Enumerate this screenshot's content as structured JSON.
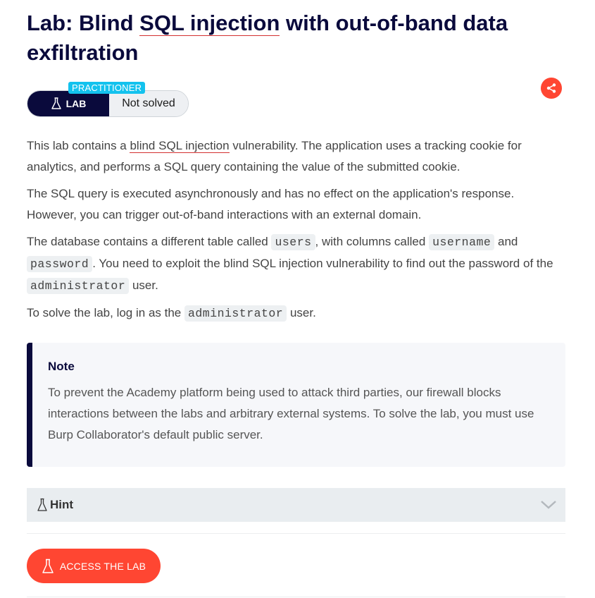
{
  "title": {
    "prefix": "Lab: Blind ",
    "link": "SQL injection",
    "suffix": " with out-of-band data exfiltration"
  },
  "badge": {
    "level": "PRACTITIONER",
    "lab_label": "LAB",
    "status": "Not solved"
  },
  "share": {
    "icon": "share-icon"
  },
  "description": {
    "p1_before": "This lab contains a ",
    "p1_link": "blind SQL injection",
    "p1_after": " vulnerability. The application uses a tracking cookie for analytics, and performs a SQL query containing the value of the submitted cookie.",
    "p2": "The SQL query is executed asynchronously and has no effect on the application's response. However, you can trigger out-of-band interactions with an external domain.",
    "p3_a": "The database contains a different table called ",
    "p3_code1": "users",
    "p3_b": ", with columns called ",
    "p3_code2": "username",
    "p3_c": " and ",
    "p3_code3": "password",
    "p3_d": ". You need to exploit the blind SQL injection vulnerability to find out the password of the ",
    "p3_code4": "administrator",
    "p3_e": " user.",
    "p4_a": "To solve the lab, log in as the ",
    "p4_code": "administrator",
    "p4_b": " user."
  },
  "note": {
    "heading": "Note",
    "text": "To prevent the Academy platform being used to attack third parties, our firewall blocks interactions between the labs and arbitrary external systems. To solve the lab, you must use Burp Collaborator's default public server."
  },
  "hint": {
    "label": "Hint"
  },
  "access_button": {
    "label": "ACCESS THE LAB"
  },
  "colors": {
    "accent": "#ff4632",
    "navy": "#0a0a3c",
    "practitioner": "#13c2ee"
  }
}
